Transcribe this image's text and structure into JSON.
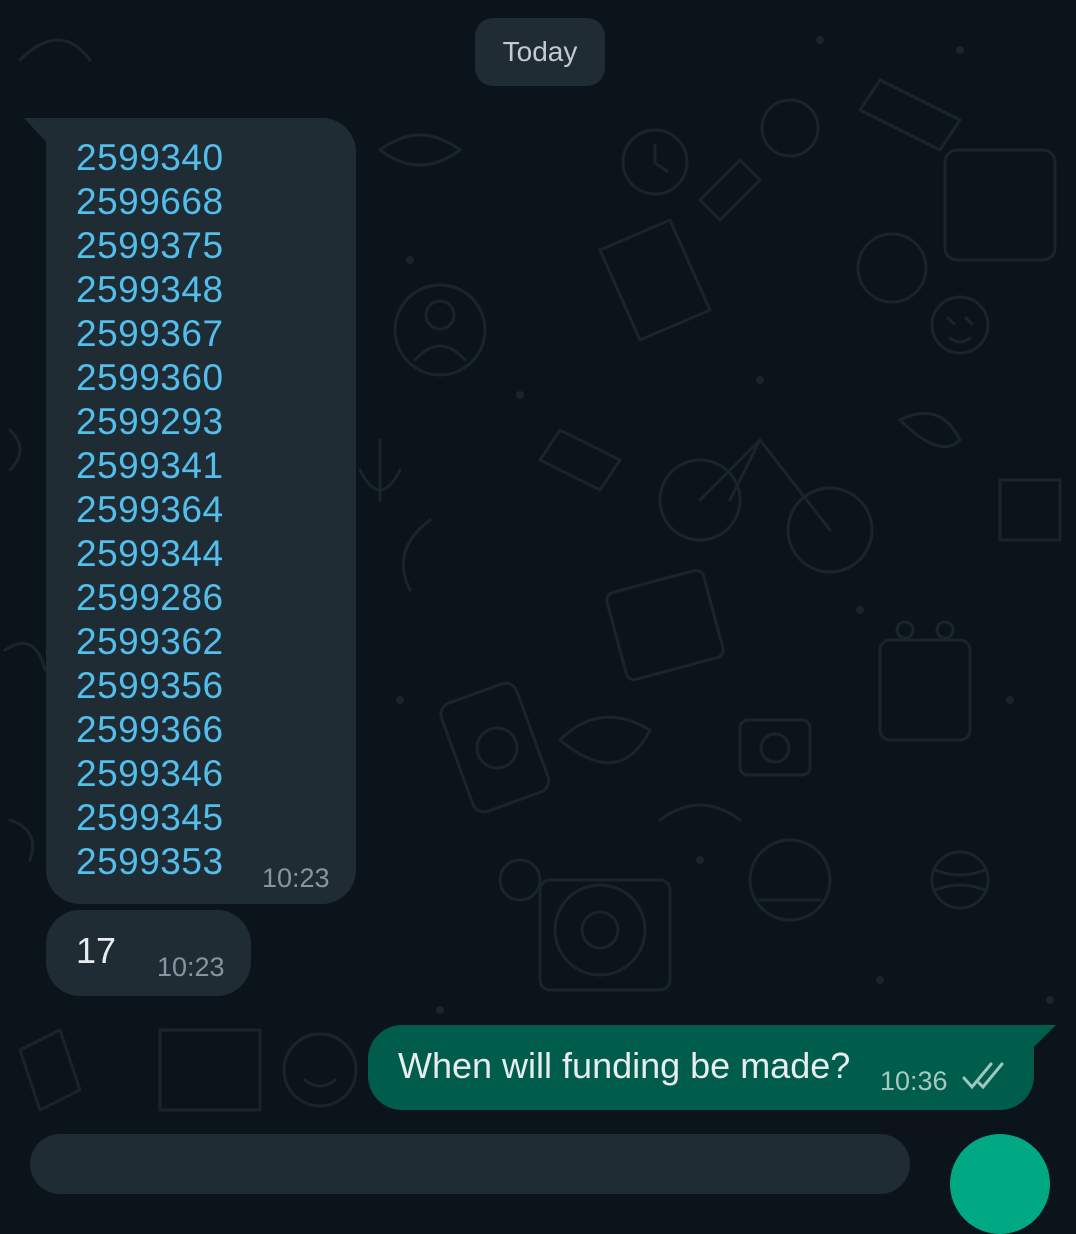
{
  "date_separator": "Today",
  "messages": [
    {
      "direction": "incoming",
      "links": [
        "2599340",
        "2599668",
        "2599375",
        "2599348",
        "2599367",
        "2599360",
        "2599293",
        "2599341",
        "2599364",
        "2599344",
        "2599286",
        "2599362",
        "2599356",
        "2599366",
        "2599346",
        "2599345",
        "2599353"
      ],
      "time": "10:23"
    },
    {
      "direction": "incoming",
      "text": "17",
      "time": "10:23"
    },
    {
      "direction": "outgoing",
      "text": "When will funding be made?",
      "time": "10:36",
      "status": "read-double-check-icon"
    }
  ],
  "colors": {
    "background": "#0b141a",
    "incoming_bubble": "#1f2c34",
    "outgoing_bubble": "#005c4b",
    "link": "#53bdeb",
    "timestamp": "#8696a0",
    "accent": "#00a884"
  }
}
